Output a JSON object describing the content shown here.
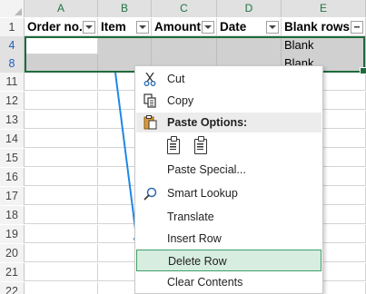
{
  "columns": [
    "A",
    "B",
    "C",
    "D",
    "E"
  ],
  "row_numbers": [
    "1",
    "4",
    "8",
    "11",
    "12",
    "13",
    "14",
    "15",
    "16",
    "17",
    "18",
    "19",
    "20",
    "21",
    "22"
  ],
  "header_row": [
    "Order no.",
    "Item",
    "Amount",
    "Date",
    "Blank rows"
  ],
  "row4": {
    "e": "Blank"
  },
  "row8": {
    "e": "Blank"
  },
  "context_menu": {
    "cut": "Cut",
    "copy": "Copy",
    "paste_options": "Paste Options:",
    "paste_special": "Paste Special...",
    "smart_lookup": "Smart Lookup",
    "translate": "Translate",
    "insert_row": "Insert Row",
    "delete_row": "Delete Row",
    "clear_contents": "Clear Contents"
  },
  "icons": [
    "scissors-icon",
    "copy-icon",
    "clipboard-icon",
    "search-icon",
    "filter-icon"
  ],
  "colors": {
    "excel_green": "#1e6b3c",
    "highlight": "#d7ede0",
    "arrow_blue": "#1e88e5"
  }
}
